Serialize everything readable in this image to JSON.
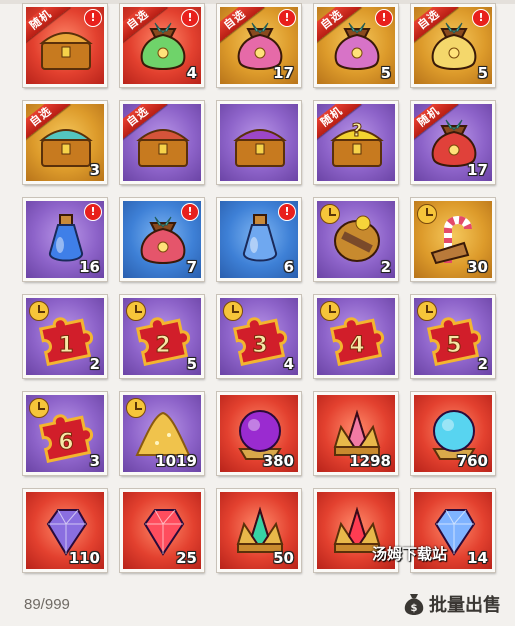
{
  "inventory": {
    "slots": [
      {
        "tag": "随机",
        "alert": true,
        "timer": false,
        "count": "",
        "bg": "red",
        "art": "red-chest",
        "accent": "#e8a73a"
      },
      {
        "tag": "自选",
        "alert": true,
        "timer": false,
        "count": "4",
        "bg": "red",
        "art": "gem-bag",
        "accent": "#6fd36a"
      },
      {
        "tag": "自选",
        "alert": true,
        "timer": false,
        "count": "17",
        "bg": "gold",
        "art": "pink-bag",
        "accent": "#e66aa8"
      },
      {
        "tag": "自选",
        "alert": true,
        "timer": false,
        "count": "5",
        "bg": "gold",
        "art": "pink-bag",
        "accent": "#d773c7"
      },
      {
        "tag": "自选",
        "alert": true,
        "timer": false,
        "count": "5",
        "bg": "gold",
        "art": "gold-bag",
        "accent": "#f4d76b"
      },
      {
        "tag": "自选",
        "alert": false,
        "timer": false,
        "count": "3",
        "bg": "gold",
        "art": "gold-chest",
        "accent": "#54c6c0"
      },
      {
        "tag": "自选",
        "alert": false,
        "timer": false,
        "count": "",
        "bg": "purple",
        "art": "red-chest",
        "accent": "#d6543a"
      },
      {
        "tag": "",
        "alert": false,
        "timer": false,
        "count": "",
        "bg": "purple",
        "art": "gold-chest",
        "accent": "#9c47c7"
      },
      {
        "tag": "随机",
        "alert": false,
        "timer": false,
        "count": "",
        "bg": "purple",
        "art": "mystery-chest",
        "accent": "#f2d331"
      },
      {
        "tag": "随机",
        "alert": false,
        "timer": false,
        "count": "17",
        "bg": "purple",
        "art": "gift-sack",
        "accent": "#e0413a"
      },
      {
        "tag": "",
        "alert": true,
        "timer": false,
        "count": "16",
        "bg": "purple",
        "art": "potion",
        "accent": "#3f7fe8"
      },
      {
        "tag": "",
        "alert": true,
        "timer": false,
        "count": "7",
        "bg": "blue",
        "art": "coin-bag",
        "accent": "#e5556b"
      },
      {
        "tag": "",
        "alert": true,
        "timer": false,
        "count": "6",
        "bg": "blue",
        "art": "flask",
        "accent": "#6fa8f0"
      },
      {
        "tag": "",
        "alert": false,
        "timer": true,
        "count": "2",
        "bg": "purple",
        "art": "scroll-medal",
        "accent": "#7a4a2a"
      },
      {
        "tag": "",
        "alert": false,
        "timer": true,
        "count": "30",
        "bg": "gold",
        "art": "candy-cane",
        "accent": "#e44a6a"
      },
      {
        "tag": "",
        "alert": false,
        "timer": true,
        "count": "2",
        "bg": "purple",
        "art": "puzzle",
        "label": "1",
        "accent": "#d11e2a"
      },
      {
        "tag": "",
        "alert": false,
        "timer": true,
        "count": "5",
        "bg": "purple",
        "art": "puzzle",
        "label": "2",
        "accent": "#d11e2a"
      },
      {
        "tag": "",
        "alert": false,
        "timer": true,
        "count": "4",
        "bg": "purple",
        "art": "puzzle",
        "label": "3",
        "accent": "#d11e2a"
      },
      {
        "tag": "",
        "alert": false,
        "timer": true,
        "count": "",
        "bg": "purple",
        "art": "puzzle",
        "label": "4",
        "accent": "#d11e2a"
      },
      {
        "tag": "",
        "alert": false,
        "timer": true,
        "count": "2",
        "bg": "purple",
        "art": "puzzle",
        "label": "5",
        "accent": "#d11e2a"
      },
      {
        "tag": "",
        "alert": false,
        "timer": true,
        "count": "3",
        "bg": "purple",
        "art": "puzzle",
        "label": "6",
        "accent": "#d11e2a"
      },
      {
        "tag": "",
        "alert": false,
        "timer": true,
        "count": "1019",
        "bg": "purple",
        "art": "sand-pile",
        "accent": "#f0c34c"
      },
      {
        "tag": "",
        "alert": false,
        "timer": false,
        "count": "380",
        "bg": "red",
        "art": "dark-orb",
        "accent": "#9a2bd0"
      },
      {
        "tag": "",
        "alert": false,
        "timer": false,
        "count": "1298",
        "bg": "red",
        "art": "crystal-crown",
        "accent": "#f27aa4"
      },
      {
        "tag": "",
        "alert": false,
        "timer": false,
        "count": "760",
        "bg": "red",
        "art": "swirl-orb",
        "accent": "#58d4f0"
      },
      {
        "tag": "",
        "alert": false,
        "timer": false,
        "count": "110",
        "bg": "red",
        "art": "gem",
        "accent": "#8a6ee0"
      },
      {
        "tag": "",
        "alert": false,
        "timer": false,
        "count": "25",
        "bg": "red",
        "art": "gem",
        "accent": "#ff4d5e"
      },
      {
        "tag": "",
        "alert": false,
        "timer": false,
        "count": "50",
        "bg": "red",
        "art": "emerald-crown",
        "accent": "#37d3a4"
      },
      {
        "tag": "",
        "alert": false,
        "timer": false,
        "count": "",
        "bg": "red",
        "art": "ruby-crown",
        "accent": "#ff3c52"
      },
      {
        "tag": "",
        "alert": false,
        "timer": false,
        "count": "14",
        "bg": "red",
        "art": "prism-gem",
        "accent": "#7fb3ff"
      }
    ]
  },
  "footer": {
    "capacity": "89/999",
    "sell_label": "批量出售",
    "sell_icon": "money-bag-icon"
  },
  "watermark": "汤姆下载站",
  "colors": {
    "alert": "#e8201c",
    "ribbon": "#d12a1e",
    "timer": "#f6c53a"
  }
}
